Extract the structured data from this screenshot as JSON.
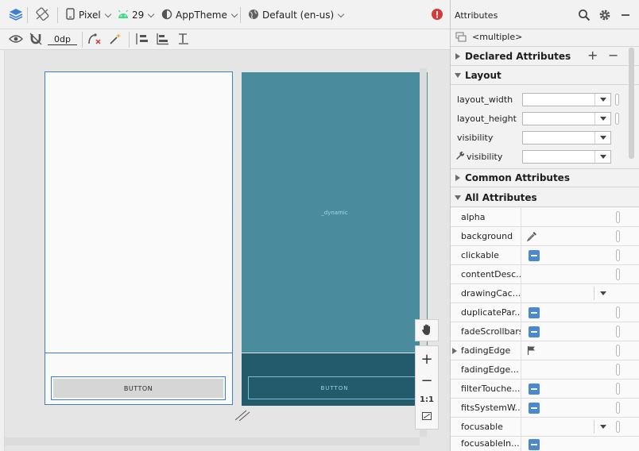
{
  "toolbar": {
    "device": "Pixel",
    "api_level": "29",
    "theme": "AppTheme",
    "locale": "Default (en-us)",
    "margin_value": "0dp"
  },
  "canvas": {
    "design_button": "BUTTON",
    "blueprint_button": "BUTTON",
    "blueprint_label": "_dynamic",
    "zoom_ratio": "1:1"
  },
  "attributes": {
    "title": "Attributes",
    "selection": "<multiple>",
    "sections": {
      "declared": "Declared Attributes",
      "layout": "Layout",
      "common": "Common Attributes",
      "all": "All Attributes"
    },
    "layout_rows": [
      {
        "label": "layout_width"
      },
      {
        "label": "layout_height"
      },
      {
        "label": "visibility"
      },
      {
        "label": "visibility"
      }
    ],
    "all_rows": [
      {
        "label": "alpha"
      },
      {
        "label": "background"
      },
      {
        "label": "clickable"
      },
      {
        "label": "contentDesc..."
      },
      {
        "label": "drawingCac..."
      },
      {
        "label": "duplicatePar..."
      },
      {
        "label": "fadeScrollbars"
      },
      {
        "label": "fadingEdge"
      },
      {
        "label": "fadingEdge..."
      },
      {
        "label": "filterTouche..."
      },
      {
        "label": "fitsSystemW..."
      },
      {
        "label": "focusable"
      },
      {
        "label": "focusableIn..."
      }
    ]
  },
  "colors": {
    "accent": "#3c7fcf",
    "blueprint": "#4a8b9e",
    "blueprint_dark": "#235a6c",
    "error": "#d93838"
  }
}
